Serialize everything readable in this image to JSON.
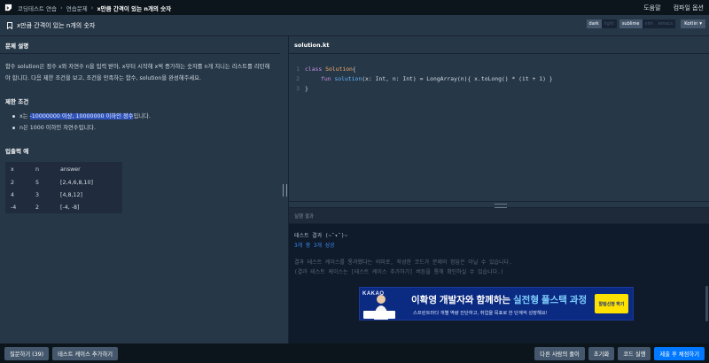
{
  "topbar": {
    "breadcrumbs": [
      "코딩테스트 연습",
      "연습문제"
    ],
    "separator": "›",
    "current": "x만큼 간격이 있는 n개의 숫자",
    "help": "도움말",
    "compiler_options": "컴파일 옵션"
  },
  "titlebar": {
    "title": "x만큼 간격이 있는 n개의 숫자",
    "theme_toggle": [
      "dark",
      "light"
    ],
    "keymap_toggle": [
      "sublime",
      "vim",
      "emacs"
    ],
    "language": "Kotlin ▾"
  },
  "problem": {
    "header": "문제 설명",
    "description": "함수 solution은 정수 x와 자연수 n을 입력 받아, x부터 시작해 x씩 증가하는 숫자를 n개 지니는 리스트를 리턴해야 합니다. 다음 제한 조건을 보고, 조건을 만족하는 함수, solution을 완성해주세요.",
    "constraints_title": "제한 조건",
    "constraint_1_prefix": "x는 ",
    "constraint_1_highlight": "-10000000 이상, 10000000 이하인 정수",
    "constraint_1_suffix": "입니다.",
    "constraint_2": "n은 1000 이하인 자연수입니다.",
    "io_title": "입출력 예",
    "io_headers": [
      "x",
      "n",
      "answer"
    ],
    "io_rows": [
      [
        "2",
        "5",
        "[2,4,6,8,10]"
      ],
      [
        "4",
        "3",
        "[4,8,12]"
      ],
      [
        "-4",
        "2",
        "[-4, -8]"
      ]
    ]
  },
  "editor": {
    "filename": "solution.kt",
    "line_numbers": [
      "1",
      "2",
      "3"
    ],
    "line1": {
      "kw": "class",
      "name": "Solution",
      "rest": " {"
    },
    "line2": {
      "kw": "fun",
      "fn": "solution",
      "params": "(x: Int, n: Int) = LongArray(n){ x.toLong() * (it + 1) }"
    },
    "line3": "}"
  },
  "result": {
    "header": "실행 결과",
    "title": "테스트 결과 (~˘▾˘)~",
    "passed": "3개 중 3개 성공",
    "note1": "결과 테스트 케이스를 통과했다는 의미로, 작성한 코드가 문제의 정답은 아닐 수 있습니다.",
    "note2": "(결과 테스트 케이스는 [테스트 케이스 추가하기] 버튼을 통해 확인하실 수 있습니다.)"
  },
  "ad": {
    "brand": "KAKAO",
    "title_prefix": "이확영 개발자와 함께하는 ",
    "title_accent": "실전형 풀스택 과정",
    "subtitle": "스프린트마다 개별 역량 진단하고, 취업을 목표로 한 단계씩 성장해요!",
    "button": "알림신청 하기"
  },
  "footer": {
    "ask": "질문하기 (39)",
    "add_test": "테스트 케이스 추가하기",
    "others": "다른 사람의 풀이",
    "reset": "초기화",
    "run": "코드 실행",
    "submit": "제출 후 채점하기"
  }
}
